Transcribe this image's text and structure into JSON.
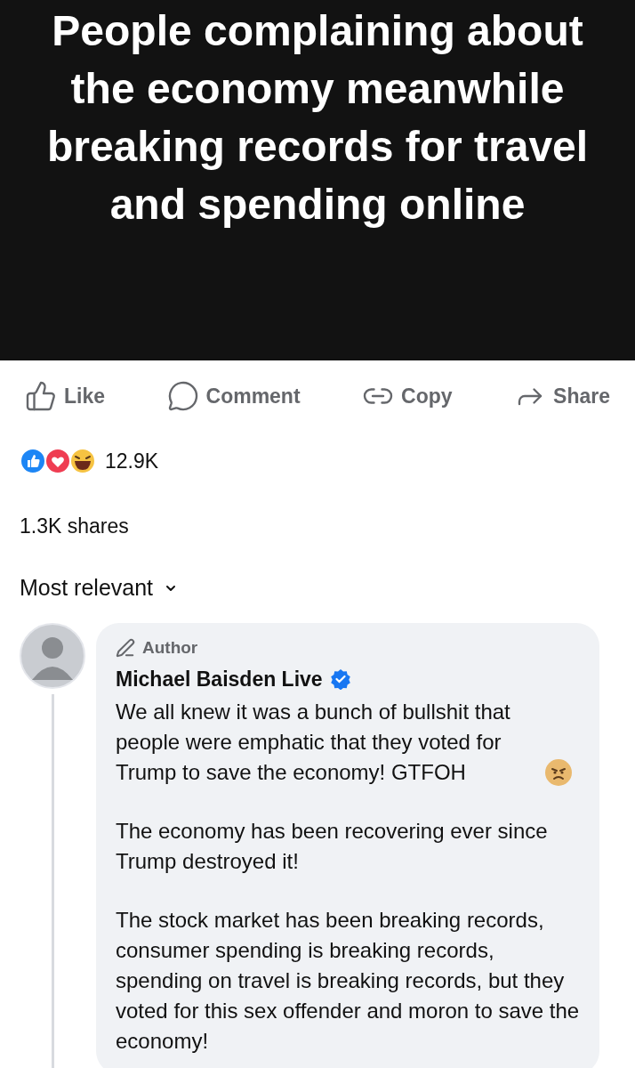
{
  "header": {
    "title": "People complaining about the economy meanwhile breaking records for travel and spending online"
  },
  "actions": [
    {
      "kind": "like",
      "label": "Like"
    },
    {
      "kind": "comment",
      "label": "Comment"
    },
    {
      "kind": "copy",
      "label": "Copy"
    },
    {
      "kind": "share",
      "label": "Share"
    }
  ],
  "reactions": {
    "count": "12.9K"
  },
  "shares": "1.3K shares",
  "sort": {
    "label": "Most relevant"
  },
  "comment": {
    "badge": "Author",
    "name": "Michael Baisden Live",
    "verified": true,
    "paragraphs": [
      {
        "text": "We all knew it was a bunch of bullshit that people were emphatic that they voted for Trump to save the economy! GTFOH",
        "trailing_emoji": true
      },
      {
        "text": "The economy has been recovering ever since Trump destroyed it!"
      },
      {
        "text": "The stock market has been breaking records, consumer spending is breaking records, spending on travel is breaking records, but they voted for this sex offender and moron to save the economy!"
      }
    ]
  }
}
